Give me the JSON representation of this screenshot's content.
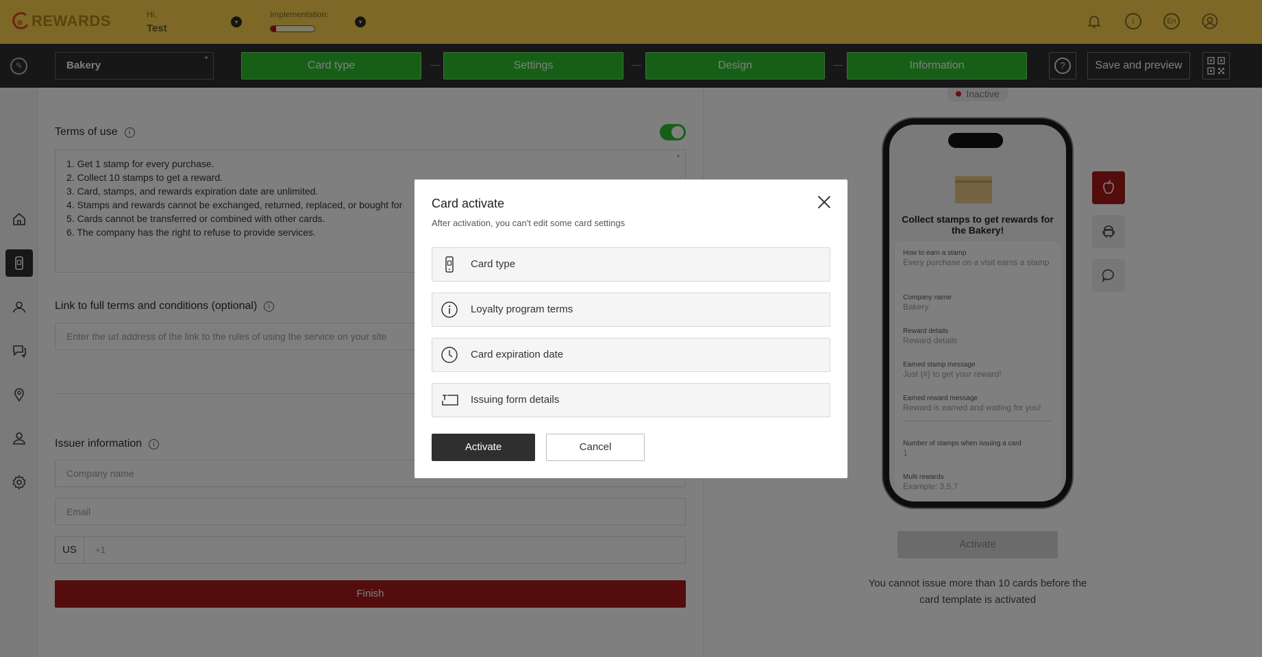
{
  "header": {
    "logo_text": "REWARDS",
    "greeting": "Hi,",
    "user_name": "Test",
    "implementation_label": "Implementation:",
    "implementation_progress": 0.12
  },
  "navbar": {
    "company": "Bakery",
    "steps": [
      "Card type",
      "Settings",
      "Design",
      "Information"
    ],
    "help_label": "?",
    "save_label": "Save and preview",
    "step_color": "#2fbf2f"
  },
  "form": {
    "terms_title": "Terms of use",
    "terms_lines": [
      "1. Get 1 stamp for every purchase.",
      "2. Collect 10 stamps to get a reward.",
      "3. Card, stamps, and rewards expiration date are unlimited.",
      "4. Stamps and rewards cannot be exchanged, returned, replaced, or bought for",
      "5. Cards cannot be transferred or combined with other cards.",
      "6. The company has the right to refuse to provide services."
    ],
    "link_title": "Link to full terms and conditions (optional)",
    "link_placeholder": "Enter the url address of the link to the rules of using the service on your site",
    "issuer_title": "Issuer information",
    "company_placeholder": "Company name",
    "email_placeholder": "Email",
    "phone_country": "US",
    "phone_prefix": "+1",
    "finish_label": "Finish"
  },
  "preview": {
    "status": "Inactive",
    "phone_title": "Collect stamps to get rewards for the Bakery!",
    "fields": [
      {
        "label": "How to earn a stamp",
        "value": "Every purchase on a visit earns a stamp"
      },
      {
        "label": "Company name",
        "value": "Bakery"
      },
      {
        "label": "Reward details",
        "value": "Reward details"
      },
      {
        "label": "Earned stamp message",
        "value": "Just {#} to get your reward!"
      },
      {
        "label": "Earned reward message",
        "value": "Reward is earned and waiting for you!"
      },
      {
        "label": "Number of stamps when issuing a card",
        "value": "1"
      },
      {
        "label": "Multi rewards",
        "value": "Example: 3,5,7"
      }
    ],
    "activate_label": "Activate",
    "limit_note": "You cannot issue more than 10 cards before the card template is activated"
  },
  "modal": {
    "title": "Card activate",
    "subtitle": "After activation, you can't edit some card settings",
    "options": [
      {
        "label": "Card type",
        "icon": "phone-card-icon"
      },
      {
        "label": "Loyalty program terms",
        "icon": "info-circle-icon"
      },
      {
        "label": "Card expiration date",
        "icon": "clock-icon"
      },
      {
        "label": "Issuing form details",
        "icon": "text-field-icon"
      }
    ],
    "activate_label": "Activate",
    "cancel_label": "Cancel"
  }
}
